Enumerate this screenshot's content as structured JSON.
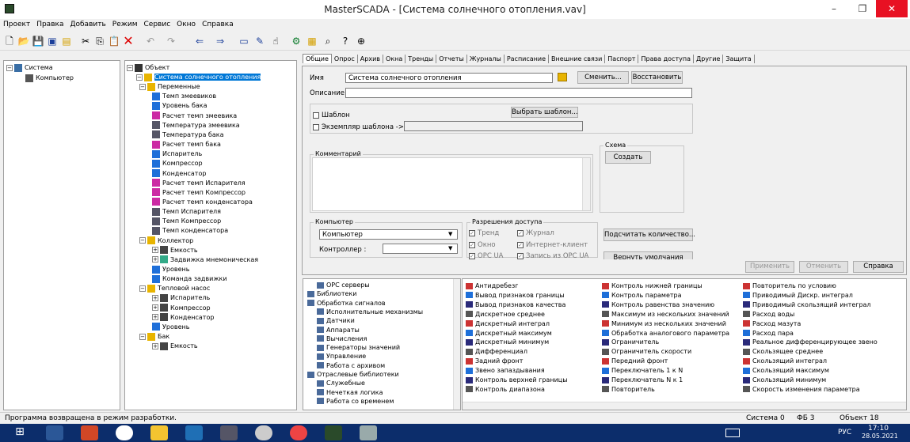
{
  "window": {
    "title": "MasterSCADA - [Система солнечного отопления.vav]",
    "minimize": "–",
    "maximize": "❐",
    "close": "✕"
  },
  "menu": [
    "Проект",
    "Правка",
    "Добавить",
    "Режим",
    "Сервис",
    "Окно",
    "Справка"
  ],
  "left_tree": {
    "root": "Система",
    "child": "Компьютер"
  },
  "obj_tree": {
    "root": "Объект",
    "items": [
      {
        "label": "Система солнечного отопления",
        "level": 1,
        "icon": "folder",
        "selected": true
      },
      {
        "label": "Переменные",
        "level": 2,
        "icon": "folder"
      },
      {
        "label": "Темп змеевиков",
        "level": 3,
        "icon": "arrow"
      },
      {
        "label": "Уровень бака",
        "level": 3,
        "icon": "arrow"
      },
      {
        "label": "Расчет темп змеевика",
        "level": 3,
        "icon": "calc"
      },
      {
        "label": "Температура змеевика",
        "level": 3,
        "icon": "input"
      },
      {
        "label": "Температура бака",
        "level": 3,
        "icon": "input"
      },
      {
        "label": "Расчет темп бака",
        "level": 3,
        "icon": "calc"
      },
      {
        "label": "Испаритель",
        "level": 3,
        "icon": "arrow"
      },
      {
        "label": "Компрессор",
        "level": 3,
        "icon": "arrow"
      },
      {
        "label": "Конденсатор",
        "level": 3,
        "icon": "arrow"
      },
      {
        "label": "Расчет темп Испарителя",
        "level": 3,
        "icon": "calc"
      },
      {
        "label": "Расчет темп Компрессор",
        "level": 3,
        "icon": "calc"
      },
      {
        "label": "Расчет темп конденсатора",
        "level": 3,
        "icon": "calc"
      },
      {
        "label": "Темп Испарителя",
        "level": 3,
        "icon": "input"
      },
      {
        "label": "Темп Компрессор",
        "level": 3,
        "icon": "input"
      },
      {
        "label": "Темп конденсатора",
        "level": 3,
        "icon": "input"
      },
      {
        "label": "Коллектор",
        "level": 2,
        "icon": "folder"
      },
      {
        "label": "Емкость",
        "level": 3,
        "icon": "device"
      },
      {
        "label": "Задвижка мнемоническая",
        "level": 3,
        "icon": "valve"
      },
      {
        "label": "Уровень",
        "level": 3,
        "icon": "arrow"
      },
      {
        "label": "Команда задвижки",
        "level": 3,
        "icon": "arrow"
      },
      {
        "label": "Тепловой насос",
        "level": 2,
        "icon": "folder"
      },
      {
        "label": "Испаритель",
        "level": 3,
        "icon": "device"
      },
      {
        "label": "Компрессор",
        "level": 3,
        "icon": "device"
      },
      {
        "label": "Конденсатор",
        "level": 3,
        "icon": "device"
      },
      {
        "label": "Уровень",
        "level": 3,
        "icon": "arrow"
      },
      {
        "label": "Бак",
        "level": 2,
        "icon": "folder"
      },
      {
        "label": "Емкость",
        "level": 3,
        "icon": "device"
      }
    ]
  },
  "tabs": [
    "Общие",
    "Опрос",
    "Архив",
    "Окна",
    "Тренды",
    "Отчеты",
    "Журналы",
    "Расписание",
    "Внешние связи",
    "Паспорт",
    "Права доступа",
    "Другие",
    "Защита"
  ],
  "form": {
    "name_label": "Имя",
    "name_value": "Система солнечного отопления",
    "change_btn": "Сменить...",
    "restore_btn": "Восстановить",
    "desc_label": "Описание",
    "desc_value": "",
    "template_chk": "Шаблон",
    "select_template_btn": "Выбрать шаблон...",
    "template_instance_chk": "Экземпляр шаблона ->",
    "comment_label": "Комментарий",
    "scheme_label": "Схема",
    "create_btn": "Создать",
    "computer_group": "Компьютер",
    "computer_value": "Компьютер",
    "controller_label": "Контроллер :",
    "controller_value": "",
    "access_group": "Разрешения доступа",
    "access": [
      "Тренд",
      "Журнал",
      "Окно",
      "Интернет-клиент",
      "ОРС UA",
      "Запись из ОРС UA"
    ],
    "count_btn": "Подсчитать количество...",
    "defaults_btn": "Вернуть умолчания",
    "apply_btn": "Применить",
    "cancel_btn": "Отменить",
    "help_btn": "Справка"
  },
  "lib_tree": [
    "ОРС серверы",
    "Библиотеки",
    "Обработка сигналов",
    "Исполнительные механизмы",
    "Датчики",
    "Аппараты",
    "Вычисления",
    "Генераторы значений",
    "Управление",
    "Работа с архивом",
    "Отраслевые библиотеки",
    "Служебные",
    "Нечеткая логика",
    "Работа со временем"
  ],
  "lib_col1": [
    "Антидребезг",
    "Вывод признаков границы",
    "Вывод признаков качества",
    "Дискретное среднее",
    "Дискретный интеграл",
    "Дискретный максимум",
    "Дискретный минимум",
    "Дифференциал",
    "Задний фронт",
    "Звено запаздывания",
    "Контроль верхней границы",
    "Контроль диапазона"
  ],
  "lib_col2": [
    "Контроль нижней границы",
    "Контроль параметра",
    "Контроль равенства значению",
    "Максимум из нескольких значений",
    "Минимум из нескольких значений",
    "Обработка аналогового параметра",
    "Ограничитель",
    "Ограничитель скорости",
    "Передний фронт",
    "Переключатель 1 к N",
    "Переключатель N к 1",
    "Повторитель"
  ],
  "lib_col3": [
    "Повторитель по условию",
    "Приводимый Дискр. интеграл",
    "Приводимый скользящий интеграл",
    "Расход воды",
    "Расход мазута",
    "Расход пара",
    "Реальное дифференцирующее звено",
    "Скользящее среднее",
    "Скользящий интеграл",
    "Скользящий максимум",
    "Скользящий минимум",
    "Скорость изменения параметра"
  ],
  "status": {
    "message": "Программа возвращена в режим разработки.",
    "system": "Система",
    "system_n": "0",
    "fb": "ФБ",
    "fb_n": "3",
    "object": "Объект",
    "object_n": "18"
  },
  "taskbar": {
    "lang": "РУС",
    "time": "17:10",
    "date": "28.05.2021"
  },
  "colors": {
    "selection": "#0078d7",
    "folder": "#e8b400",
    "arrow": "#1e6fd9",
    "calc": "#cc2aa4",
    "close": "#e81123"
  }
}
